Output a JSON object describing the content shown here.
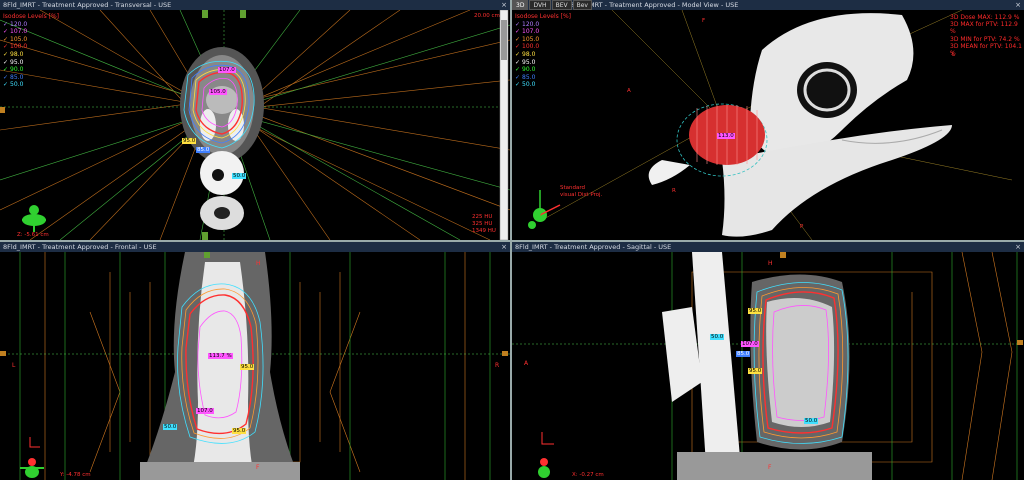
{
  "viewports": {
    "transversal": {
      "title": "8Fld_IMRT - Treatment Approved - Transversal - USE",
      "close": "×",
      "legend_header": "Isodose Levels [%]",
      "scale": "20.00 cm",
      "position": "Z: -5.61 cm",
      "readout": [
        "225 HU",
        "325 HU",
        "1349 HU"
      ]
    },
    "model": {
      "title": "8Fld_IMRT - Treatment Approved - Model View - USE",
      "close": "×",
      "tabs": [
        "3D",
        "DVH",
        "BEV",
        "Bev"
      ],
      "legend_header": "Isodose Levels [%]",
      "dose_info": [
        "3D Dose MAX: 112.9 %",
        "3D MAX for PTV: 112.9 %",
        "3D MIN for PTV: 74.2 %",
        "3D MEAN for PTV: 104.1 %"
      ],
      "axis_label": "Standard\nvisual Dist Proj.",
      "side_labels": [
        "F",
        "L",
        "A",
        "R",
        "P"
      ]
    },
    "frontal": {
      "title": "8Fld_IMRT - Treatment Approved - Frontal - USE",
      "close": "×",
      "side_labels": {
        "top": "H",
        "left": "L",
        "right": "R",
        "bottom": "F"
      },
      "position": "Y: -4.78 cm"
    },
    "sagittal": {
      "title": "8Fld_IMRT - Treatment Approved - Sagittal - USE",
      "close": "×",
      "side_labels": {
        "top": "H",
        "left": "A",
        "bottom": "F"
      },
      "position": "X: -0.27 cm"
    }
  },
  "isodose_levels": [
    {
      "value": "120.0",
      "color": "#b07cff"
    },
    {
      "value": "107.0",
      "color": "#ff55ff"
    },
    {
      "value": "105.0",
      "color": "#ff9a30"
    },
    {
      "value": "100.0",
      "color": "#ff3030"
    },
    {
      "value": "98.0",
      "color": "#ffe040"
    },
    {
      "value": "95.0",
      "color": "#ffffff"
    },
    {
      "value": "90.0",
      "color": "#30ff30"
    },
    {
      "value": "85.0",
      "color": "#4080ff"
    },
    {
      "value": "50.0",
      "color": "#40e0ff"
    }
  ],
  "contour_labels": {
    "t1": "107.0",
    "t2": "105.0",
    "t3": "95.0",
    "t4": "85.0",
    "t5": "50.0",
    "m1": "113.0",
    "f1": "113.7 %",
    "f2": "95.0",
    "f3": "107.0",
    "f4": "50.0",
    "f5": "95.0",
    "s1": "95.0",
    "s2": "50.0",
    "s3": "107.0",
    "s4": "85.0",
    "s5": "95.0",
    "s6": "50.0"
  }
}
